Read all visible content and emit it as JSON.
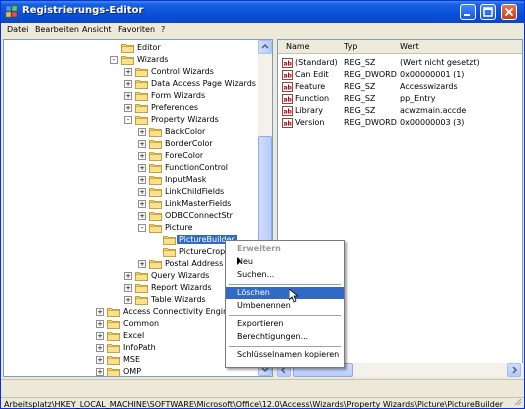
{
  "window": {
    "title": "Registrierungs-Editor"
  },
  "menubar": [
    "Datei",
    "Bearbeiten",
    "Ansicht",
    "Favoriten",
    "?"
  ],
  "tree": [
    {
      "label": "Editor",
      "expander": "",
      "indent": 0
    },
    {
      "label": "Wizards",
      "expander": "-",
      "indent": 0
    },
    {
      "label": "Control Wizards",
      "expander": "+",
      "indent": 1
    },
    {
      "label": "Data Access Page Wizards",
      "expander": "+",
      "indent": 1
    },
    {
      "label": "Form Wizards",
      "expander": "+",
      "indent": 1
    },
    {
      "label": "Preferences",
      "expander": "+",
      "indent": 1
    },
    {
      "label": "Property Wizards",
      "expander": "-",
      "indent": 1
    },
    {
      "label": "BackColor",
      "expander": "+",
      "indent": 2
    },
    {
      "label": "BorderColor",
      "expander": "+",
      "indent": 2
    },
    {
      "label": "ForeColor",
      "expander": "+",
      "indent": 2
    },
    {
      "label": "FunctionControl",
      "expander": "+",
      "indent": 2
    },
    {
      "label": "InputMask",
      "expander": "+",
      "indent": 2
    },
    {
      "label": "LinkChildFields",
      "expander": "+",
      "indent": 2
    },
    {
      "label": "LinkMasterFields",
      "expander": "+",
      "indent": 2
    },
    {
      "label": "ODBCConnectStr",
      "expander": "+",
      "indent": 2
    },
    {
      "label": "Picture",
      "expander": "-",
      "indent": 2
    },
    {
      "label": "PictureBuilder",
      "expander": "",
      "indent": 3,
      "selected": true
    },
    {
      "label": "PictureCrop",
      "expander": "",
      "indent": 3
    },
    {
      "label": "Postal Address",
      "expander": "+",
      "indent": 2
    },
    {
      "label": "Query Wizards",
      "expander": "+",
      "indent": 1
    },
    {
      "label": "Report Wizards",
      "expander": "+",
      "indent": 1
    },
    {
      "label": "Table Wizards",
      "expander": "+",
      "indent": 1
    },
    {
      "label": "Access Connectivity Engine",
      "expander": "+",
      "indent": -1
    },
    {
      "label": "Common",
      "expander": "+",
      "indent": -1
    },
    {
      "label": "Excel",
      "expander": "+",
      "indent": -1
    },
    {
      "label": "InfoPath",
      "expander": "+",
      "indent": -1
    },
    {
      "label": "MSE",
      "expander": "+",
      "indent": -1
    },
    {
      "label": "OMP",
      "expander": "+",
      "indent": -1
    }
  ],
  "list": {
    "headers": [
      "Name",
      "Typ",
      "Wert"
    ],
    "rows": [
      {
        "name": "(Standard)",
        "type": "REG_SZ",
        "value": "(Wert nicht gesetzt)"
      },
      {
        "name": "Can Edit",
        "type": "REG_DWORD",
        "value": "0x00000001 (1)"
      },
      {
        "name": "Feature",
        "type": "REG_SZ",
        "value": "Accesswizards"
      },
      {
        "name": "Function",
        "type": "REG_SZ",
        "value": "pp_Entry"
      },
      {
        "name": "Library",
        "type": "REG_SZ",
        "value": "acwzmain.accde"
      },
      {
        "name": "Version",
        "type": "REG_DWORD",
        "value": "0x00000003 (3)"
      }
    ]
  },
  "context_menu": {
    "items": [
      {
        "label": "Erweitern",
        "disabled": true
      },
      {
        "label": "Neu",
        "submenu": true
      },
      {
        "label": "Suchen..."
      },
      {
        "sep": true
      },
      {
        "label": "Löschen",
        "hover": true
      },
      {
        "label": "Umbenennen"
      },
      {
        "sep": true
      },
      {
        "label": "Exportieren"
      },
      {
        "label": "Berechtigungen..."
      },
      {
        "sep": true
      },
      {
        "label": "Schlüsselnamen kopieren"
      }
    ]
  },
  "status": {
    "path": "Arbeitsplatz\\HKEY_LOCAL_MACHINE\\SOFTWARE\\Microsoft\\Office\\12.0\\Access\\Wizards\\Property Wizards\\Picture\\PictureBuilder"
  }
}
